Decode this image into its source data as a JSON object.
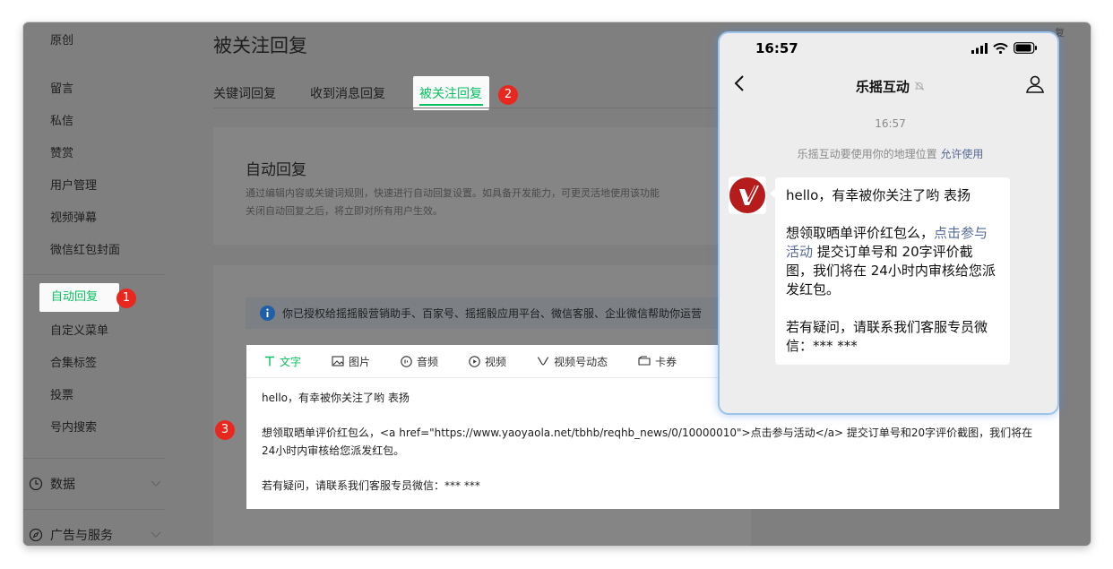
{
  "sidebar": {
    "items_top": [
      "原创"
    ],
    "items": [
      "留言",
      "私信",
      "赞赏",
      "用户管理",
      "视频弹幕",
      "微信红包封面"
    ],
    "active": "自动回复",
    "items_bottom": [
      "自定义菜单",
      "合集标签",
      "投票",
      "号内搜索"
    ],
    "sections": [
      "数据",
      "广告与服务"
    ]
  },
  "badges": [
    "1",
    "2",
    "3"
  ],
  "header": {
    "title": "被关注回复",
    "tabs": [
      "关键词回复",
      "收到消息回复",
      "被关注回复"
    ],
    "corner": "复"
  },
  "intro": {
    "title": "自动回复",
    "desc_line1": "通过编辑内容或关键词规则，快速进行自动回复设置。如具备开发能力，可更灵活地使用该功能",
    "desc_line2": "关闭自动回复之后，将立即对所有用户生效。"
  },
  "notice": {
    "text": "你已授权给摇摇骰营销助手、百家号、摇摇骰应用平台、微信客服、企业微信帮助你运营"
  },
  "editor": {
    "tabs": [
      "文字",
      "图片",
      "音频",
      "视频",
      "视频号动态",
      "卡券"
    ],
    "line1": "hello，有幸被你关注了哟 表扬",
    "line2": "想领取晒单评价红包么，<a href=\"https://www.yaoyaola.net/tbhb/reqhb_news/0/10000010\">点击参与活动</a> 提交订单号和20字评价截图，我们将在24小时内审核给您派发红包。",
    "line3": "若有疑问，请联系我们客服专员微信：*** ***"
  },
  "phone": {
    "status_time": "16:57",
    "chat_title": "乐摇互动",
    "chat_time": "16:57",
    "location_text": "乐摇互动要使用你的地理位置",
    "location_link": "允许使用",
    "msg_line1": "hello，有幸被你关注了哟 表扬",
    "msg_p2_pre": "想领取晒单评价红包么，",
    "msg_p2_link": "点击参与活动",
    "msg_p2_post": " 提交订单号和 20字评价截图，我们将在 24小时内审核给您派发红包。",
    "msg_line3": "若有疑问，请联系我们客服专员微信：*** ***"
  },
  "colors": {
    "accent": "#07c160",
    "badge": "#e8281f",
    "link": "#576b95"
  }
}
